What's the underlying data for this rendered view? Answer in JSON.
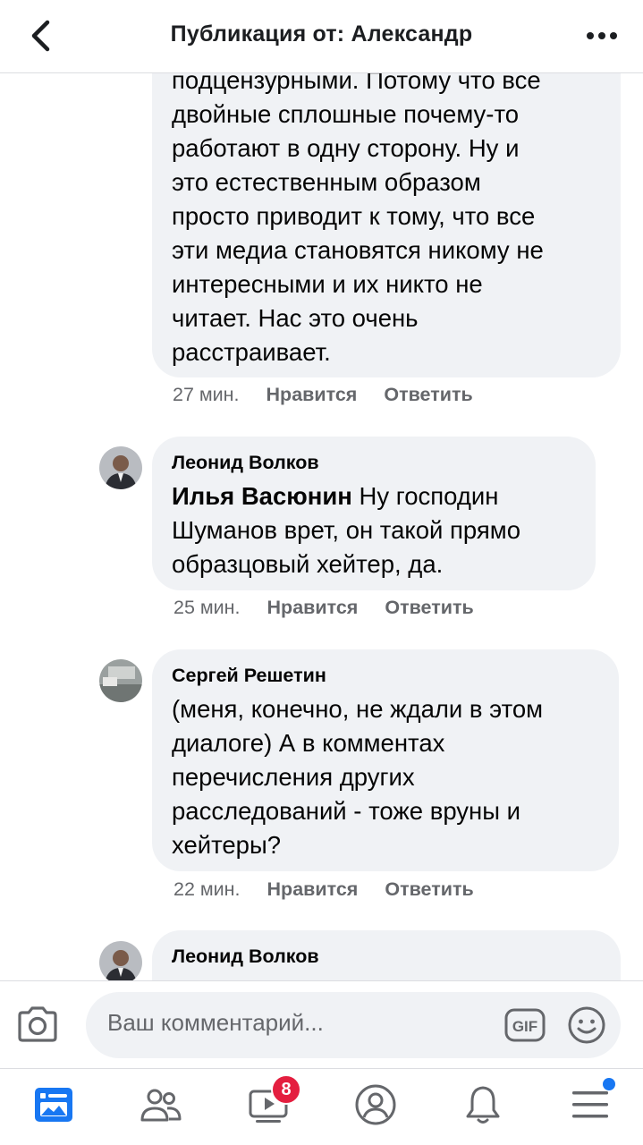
{
  "header": {
    "title": "Публикация от: Александр"
  },
  "comments": [
    {
      "text": "подцензурными. Потому что все двойные сплошные почему-то работают в одну сторону. Ну и это естественным образом просто приводит к тому, что все эти медиа становятся никому не интересными и их никто не читает. Нас это очень расстраивает.",
      "lines": [
        "подцензурными. Потому что все",
        "двойные сплошные почему-то",
        "работают в одну сторону. Ну и",
        "это естественным образом",
        "просто приводит к тому, что все",
        "эти медиа становятся никому не",
        "интересными и их никто не",
        "читает. Нас это очень",
        "расстраивает."
      ],
      "time": "27 мин.",
      "like": "Нравится",
      "reply": "Ответить"
    },
    {
      "author": "Леонид Волков",
      "mention": "Илья Васюнин",
      "lines": [
        " Ну господин",
        "Шуманов врет, он такой прямо",
        "образцовый хейтер, да."
      ],
      "time": "25 мин.",
      "like": "Нравится",
      "reply": "Ответить"
    },
    {
      "author": "Сергей Решетин",
      "lines": [
        "(меня, конечно, не ждали в этом",
        "диалоге) А в комментах",
        "перечисления других",
        "расследований - тоже вруны и",
        "хейтеры?"
      ],
      "time": "22 мин.",
      "like": "Нравится",
      "reply": "Ответить"
    },
    {
      "author": "Леонид Волков"
    }
  ],
  "composer": {
    "placeholder": "Ваш комментарий...",
    "gif_label": "GIF"
  },
  "tabbar": {
    "items": [
      "news-feed-icon",
      "friends-icon",
      "watch-icon",
      "profile-icon",
      "notifications-icon",
      "menu-icon"
    ],
    "watch_badge": "8",
    "active_color": "#1877f2"
  }
}
